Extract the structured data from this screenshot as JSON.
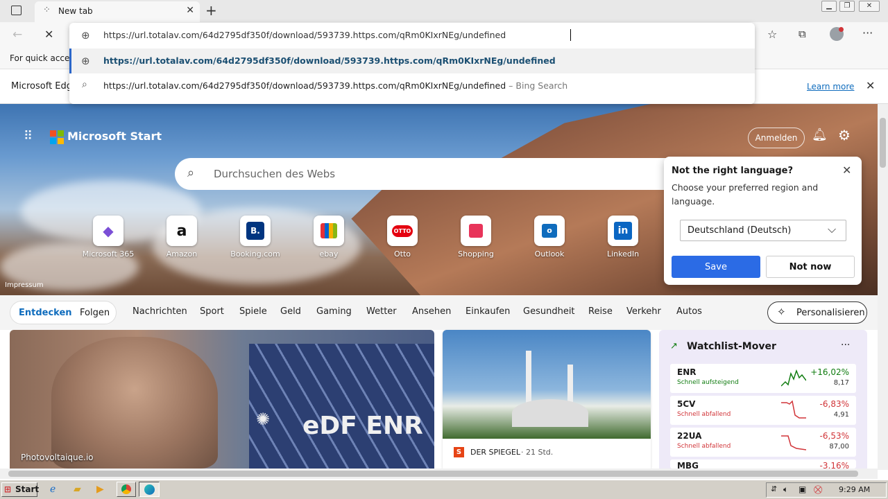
{
  "browser": {
    "tab_title": "New tab",
    "address_value": "https://url.totalav.com/64d2795df350f/download/593739.https.com/qRm0KIxrNEg/undefined",
    "suggestions": [
      {
        "text": "https://url.totalav.com/64d2795df350f/download/593739.https.com/qRm0KIxrNEg/undefined",
        "kind": "url"
      },
      {
        "text": "https://url.totalav.com/64d2795df350f/download/593739.https.com/qRm0KIxrNEg/undefined",
        "suffix": "– Bing Search",
        "kind": "search"
      }
    ],
    "favorites_text": "For quick access",
    "infobar_text": "Microsoft Edg",
    "infobar_link": "Learn more"
  },
  "start": {
    "brand": "Microsoft Start",
    "search_placeholder": "Durchsuchen des Webs",
    "signin": "Anmelden",
    "impressum": "Impressum",
    "quick_links": [
      {
        "label": "Microsoft 365",
        "icon": "m365-icon",
        "glyph": "◆",
        "color": "#7b4fd6"
      },
      {
        "label": "Amazon",
        "icon": "amazon-icon",
        "glyph": "a",
        "color": "#111"
      },
      {
        "label": "Booking.com",
        "icon": "booking-icon",
        "glyph": "B.",
        "color": "#fff"
      },
      {
        "label": "ebay",
        "icon": "ebay-icon",
        "glyph": "▣",
        "color": "#e53238"
      },
      {
        "label": "Otto",
        "icon": "otto-icon",
        "glyph": "OTTO",
        "color": "#fff"
      },
      {
        "label": "Shopping",
        "icon": "shopping-icon",
        "glyph": "▲",
        "color": "#fff"
      },
      {
        "label": "Outlook",
        "icon": "outlook-icon",
        "glyph": "o",
        "color": "#fff"
      },
      {
        "label": "LinkedIn",
        "icon": "linkedin-icon",
        "glyph": "in",
        "color": "#fff"
      }
    ],
    "language_popup": {
      "title": "Not the right language?",
      "body": "Choose your preferred region and language.",
      "select_value": "Deutschland (Deutsch)",
      "save": "Save",
      "not_now": "Not now"
    },
    "nav_tabs": [
      "Entdecken",
      "Folgen"
    ],
    "nav_items": [
      "Nachrichten",
      "Sport",
      "Spiele",
      "Geld",
      "Gaming",
      "Wetter",
      "Ansehen",
      "Einkaufen",
      "Gesundheit",
      "Reise",
      "Verkehr",
      "Autos"
    ],
    "personalize": "Personalisieren",
    "card1_source": "Photovoltaique.io",
    "card1_brand": "eDF ENR",
    "card2_source": "DER SPIEGEL",
    "card2_time": "· 21 Std.",
    "watchlist": {
      "title": "Watchlist-Mover",
      "rows": [
        {
          "symbol": "ENR",
          "sub": "Schnell aufsteigend",
          "pct": "+16,02%",
          "price": "8,17",
          "up": true
        },
        {
          "symbol": "5CV",
          "sub": "Schnell abfallend",
          "pct": "-6,83%",
          "price": "4,91",
          "up": false
        },
        {
          "symbol": "22UA",
          "sub": "Schnell abfallend",
          "pct": "-6,53%",
          "price": "87,00",
          "up": false
        },
        {
          "symbol": "MBG",
          "sub": "",
          "pct": "-3,16%",
          "price": "",
          "up": false
        }
      ]
    }
  },
  "taskbar": {
    "start": "Start",
    "clock": "9:29 AM"
  },
  "colors": {
    "accent": "#0f6cbd",
    "save_btn": "#2b6be5",
    "up": "#107c10",
    "down": "#d13438"
  }
}
